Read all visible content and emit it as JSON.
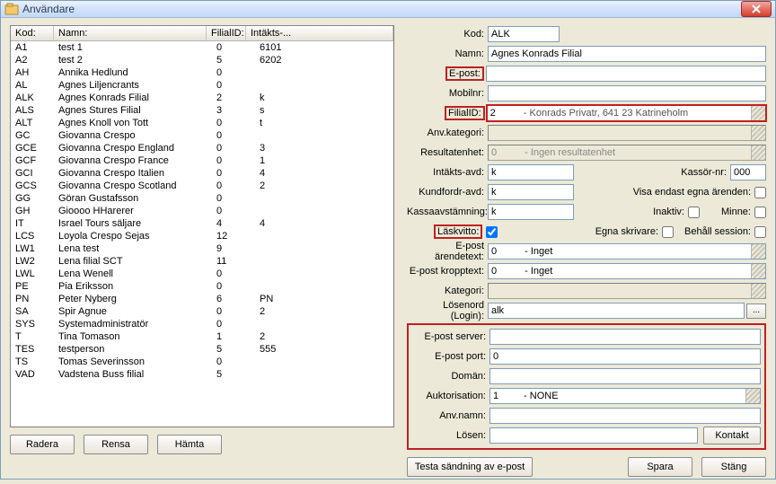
{
  "window": {
    "title": "Användare"
  },
  "grid": {
    "headers": {
      "kod": "Kod:",
      "namn": "Namn:",
      "filial": "FilialID:",
      "intakt": "Intäkts-..."
    },
    "rows": [
      {
        "kod": "A1",
        "namn": "test 1",
        "filial": "0",
        "int": "6101"
      },
      {
        "kod": "A2",
        "namn": "test 2",
        "filial": "5",
        "int": "6202"
      },
      {
        "kod": "AH",
        "namn": "Annika Hedlund",
        "filial": "0",
        "int": ""
      },
      {
        "kod": "AL",
        "namn": "Agnes Liljencrants",
        "filial": "0",
        "int": ""
      },
      {
        "kod": "ALK",
        "namn": "Agnes Konrads Filial",
        "filial": "2",
        "int": "k"
      },
      {
        "kod": "ALS",
        "namn": "Agnes Stures Filial",
        "filial": "3",
        "int": "s"
      },
      {
        "kod": "ALT",
        "namn": "Agnes Knoll von Tott",
        "filial": "0",
        "int": "t"
      },
      {
        "kod": "GC",
        "namn": "Giovanna Crespo",
        "filial": "0",
        "int": ""
      },
      {
        "kod": "GCE",
        "namn": "Giovanna Crespo England",
        "filial": "0",
        "int": "3"
      },
      {
        "kod": "GCF",
        "namn": "Giovanna Crespo  France",
        "filial": "0",
        "int": "1"
      },
      {
        "kod": "GCI",
        "namn": "Giovanna Crespo Italien",
        "filial": "0",
        "int": "4"
      },
      {
        "kod": "GCS",
        "namn": "Giovanna Crespo Scotland",
        "filial": "0",
        "int": "2"
      },
      {
        "kod": "GG",
        "namn": "Göran Gustafsson",
        "filial": "0",
        "int": ""
      },
      {
        "kod": "GH",
        "namn": "Gioooo HHarerer",
        "filial": "0",
        "int": ""
      },
      {
        "kod": "IT",
        "namn": "Israel Tours säljare",
        "filial": "4",
        "int": "4"
      },
      {
        "kod": "LCS",
        "namn": "Loyola Crespo Sejas",
        "filial": "12",
        "int": ""
      },
      {
        "kod": "LW1",
        "namn": "Lena test",
        "filial": "9",
        "int": ""
      },
      {
        "kod": "LW2",
        "namn": "Lena filial SCT",
        "filial": "11",
        "int": ""
      },
      {
        "kod": "LWL",
        "namn": "Lena Wenell",
        "filial": "0",
        "int": ""
      },
      {
        "kod": "PE",
        "namn": "Pia Eriksson",
        "filial": "0",
        "int": ""
      },
      {
        "kod": "PN",
        "namn": "Peter Nyberg",
        "filial": "6",
        "int": "PN"
      },
      {
        "kod": "SA",
        "namn": "Spir Agnue",
        "filial": "0",
        "int": "2"
      },
      {
        "kod": "SYS",
        "namn": "Systemadministratör",
        "filial": "0",
        "int": ""
      },
      {
        "kod": "T",
        "namn": "Tina Tomason",
        "filial": "1",
        "int": "2"
      },
      {
        "kod": "TES",
        "namn": "testperson",
        "filial": "5",
        "int": "555"
      },
      {
        "kod": "TS",
        "namn": "Tomas Severinsson",
        "filial": "0",
        "int": ""
      },
      {
        "kod": "VAD",
        "namn": "Vadstena Buss filial",
        "filial": "5",
        "int": ""
      }
    ]
  },
  "buttons": {
    "radera": "Radera",
    "rensa": "Rensa",
    "hamta": "Hämta",
    "testa": "Testa sändning av e-post",
    "spara": "Spara",
    "stang": "Stäng",
    "kontakt": "Kontakt"
  },
  "form": {
    "kod": {
      "label": "Kod:",
      "value": "ALK"
    },
    "namn": {
      "label": "Namn:",
      "value": "Agnes Konrads Filial"
    },
    "epost": {
      "label": "E-post:",
      "value": ""
    },
    "mobilnr": {
      "label": "Mobilnr:",
      "value": ""
    },
    "filialid": {
      "label": "FilialID:",
      "value": "2",
      "desc": "  - Konrads Privatr, 641 23 Katrineholm"
    },
    "anvkategori": {
      "label": "Anv.kategori:",
      "value": ""
    },
    "resultatenhet": {
      "label": "Resultatenhet:",
      "value": "0",
      "desc": "  - Ingen resultatenhet"
    },
    "intaktsavd": {
      "label": "Intäkts-avd:",
      "value": "k"
    },
    "kassornr": {
      "label": "Kassör-nr:",
      "value": "000"
    },
    "kundfordravd": {
      "label": "Kundfordr-avd:",
      "value": "k"
    },
    "visaegna": {
      "label": "Visa endast egna ärenden:"
    },
    "kassaavst": {
      "label": "Kassaavstämning:",
      "value": "k"
    },
    "inaktiv": {
      "label": "Inaktiv:"
    },
    "minne": {
      "label": "Minne:"
    },
    "laskvitto": {
      "label": "Läskvitto:"
    },
    "egnaskrivare": {
      "label": "Egna skrivare:"
    },
    "behallsession": {
      "label": "Behåll session:"
    },
    "epostarende": {
      "label": "E-post ärendetext:",
      "value": "0",
      "desc": "  - Inget"
    },
    "epostkropp": {
      "label": "E-post kropptext:",
      "value": "0",
      "desc": "  - Inget"
    },
    "kategori": {
      "label": "Kategori:",
      "value": ""
    },
    "losenord": {
      "label": "Lösenord (Login):",
      "value": "alk"
    },
    "epostserver": {
      "label": "E-post server:",
      "value": ""
    },
    "epostport": {
      "label": "E-post port:",
      "value": "0"
    },
    "doman": {
      "label": "Domän:",
      "value": ""
    },
    "auktorisation": {
      "label": "Auktorisation:",
      "value": "1",
      "desc": " - NONE"
    },
    "anvnamn": {
      "label": "Anv.namn:",
      "value": ""
    },
    "losen": {
      "label": "Lösen:",
      "value": ""
    }
  }
}
